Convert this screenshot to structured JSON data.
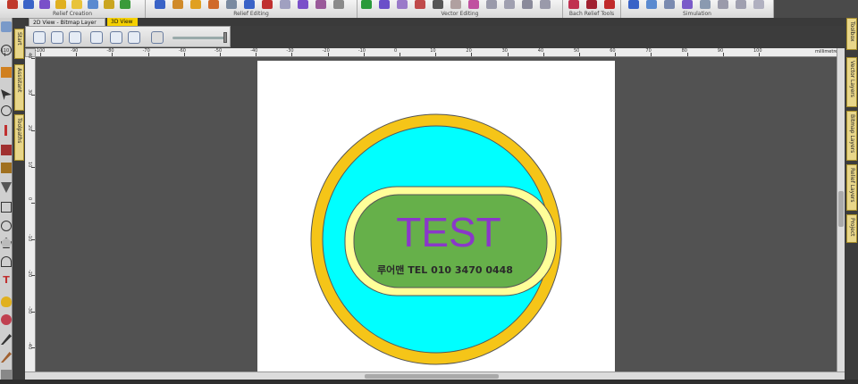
{
  "ribbon": {
    "groups": [
      {
        "label": "Relief Creation"
      },
      {
        "label": "Relief Editing"
      },
      {
        "label": "Vector Editing"
      },
      {
        "label": "Bach Relief Tools"
      },
      {
        "label": "Simulation"
      }
    ]
  },
  "tabs": {
    "view2d": "2D View - Bitmap Layer",
    "view3d": "3D View"
  },
  "toolbar2d": {
    "icons": [
      "zoom-in-icon",
      "zoom-out-icon",
      "zoom-fit-icon",
      "zoom-box-icon",
      "zoom-page-icon",
      "pan-icon",
      "snapshot-icon"
    ]
  },
  "left_panel_tabs": [
    "Start",
    "Assistant",
    "Toolpaths"
  ],
  "right_panel_tabs": [
    "Toolbox",
    "Vector Layers",
    "Bitmap Layers",
    "Relief Layers",
    "Project"
  ],
  "ruler": {
    "units": "millimetres",
    "top_labels": [
      "-110",
      "-100",
      "-90",
      "-80",
      "-70",
      "-60",
      "-50",
      "-40",
      "-30",
      "-20",
      "-10",
      "0",
      "10",
      "20",
      "30",
      "40",
      "50",
      "60",
      "70",
      "80",
      "90",
      "100"
    ],
    "left_labels": [
      "90",
      "80",
      "70",
      "60",
      "50",
      "40",
      "30",
      "20",
      "10",
      "0",
      "-10",
      "-20",
      "-30",
      "-40",
      "-50",
      "-60",
      "-70",
      "-80",
      "-90"
    ]
  },
  "artwork": {
    "title": "TEST",
    "subtitle": "루어맨 TEL 010 3470 0448",
    "colors": {
      "outer_ring": "#f5c518",
      "inner_disc": "#00ffff",
      "badge_border": "#ffff99",
      "badge_fill": "#66b04a",
      "title": "#8a38c9",
      "subtitle": "#2a2a2a",
      "outline": "#555555"
    }
  }
}
